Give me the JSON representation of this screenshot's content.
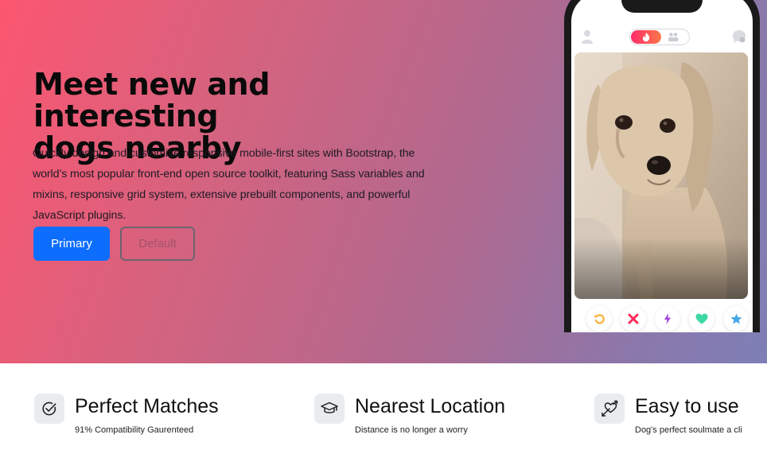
{
  "hero": {
    "title_line1": "Meet new and interesting",
    "title_line2": "dogs nearby",
    "description": "Quickly design and customize responsive mobile-first sites with Bootstrap, the world’s most popular front-end open source toolkit, featuring Sass variables and mixins, responsive grid system, extensive prebuilt components, and powerful JavaScript plugins.",
    "primary_button": "Primary",
    "default_button": "Default"
  },
  "phone": {
    "top_bar_icons": [
      "profile-icon",
      "flame-icon",
      "people-icon",
      "chat-icon"
    ],
    "photo_subject": "dog-photo",
    "actions": [
      {
        "name": "rewind-button",
        "icon": "undo-icon",
        "color": "#f5b748"
      },
      {
        "name": "nope-button",
        "icon": "x-icon",
        "color": "#fd2b59"
      },
      {
        "name": "boost-button",
        "icon": "lightning-icon",
        "color": "#a144e0"
      },
      {
        "name": "like-button",
        "icon": "heart-icon",
        "color": "#3fd8a4"
      },
      {
        "name": "super-like-button",
        "icon": "star-icon",
        "color": "#44a8e8"
      }
    ]
  },
  "features": [
    {
      "title": "Perfect Matches",
      "subtitle": "91% Compatibility Gaurenteed",
      "icon": "check-circle-icon"
    },
    {
      "title": "Nearest Location",
      "subtitle": "Distance is no longer a worry",
      "icon": "mortarboard-icon"
    },
    {
      "title": "Easy to use",
      "subtitle": "Dog's perfect soulmate a cli",
      "icon": "heart-arrow-icon"
    }
  ],
  "colors": {
    "gradient_start": "#fc5670",
    "gradient_end": "#7d7fb6",
    "primary": "#0d6efd"
  }
}
